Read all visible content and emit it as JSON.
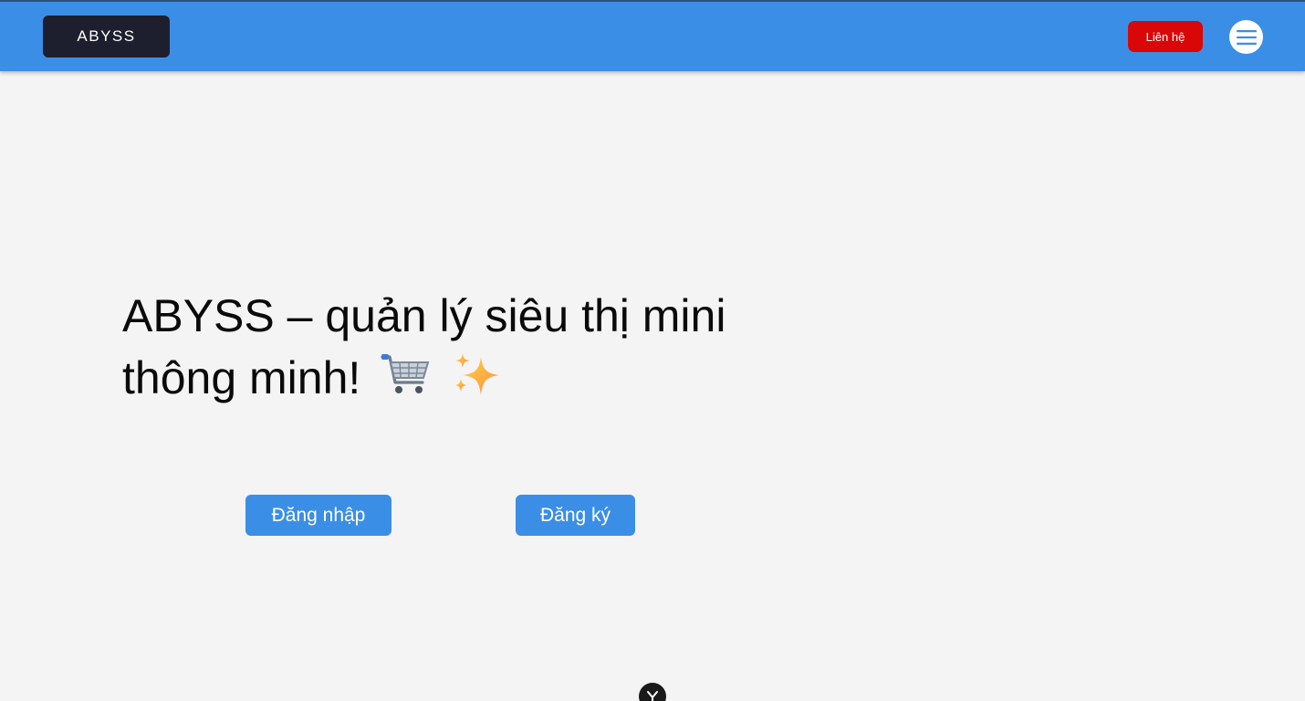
{
  "header": {
    "logo_text": "ABYSS",
    "contact_label": "Liên hệ",
    "menu_icon": "hamburger-menu-icon"
  },
  "hero": {
    "headline": "ABYSS – quản lý siêu thị mini thông minh!",
    "emojis": [
      "shopping-cart-icon",
      "sparkles-icon"
    ]
  },
  "auth": {
    "login_label": "Đăng nhập",
    "register_label": "Đăng ký"
  },
  "scroll": {
    "icon": "chevron-down-icon"
  },
  "colors": {
    "header_bg": "#3a8ee6",
    "logo_bg": "#1d1f2e",
    "contact_bg": "#d90707",
    "button_bg": "#3a8ee6",
    "page_bg": "#f4f4f4"
  }
}
